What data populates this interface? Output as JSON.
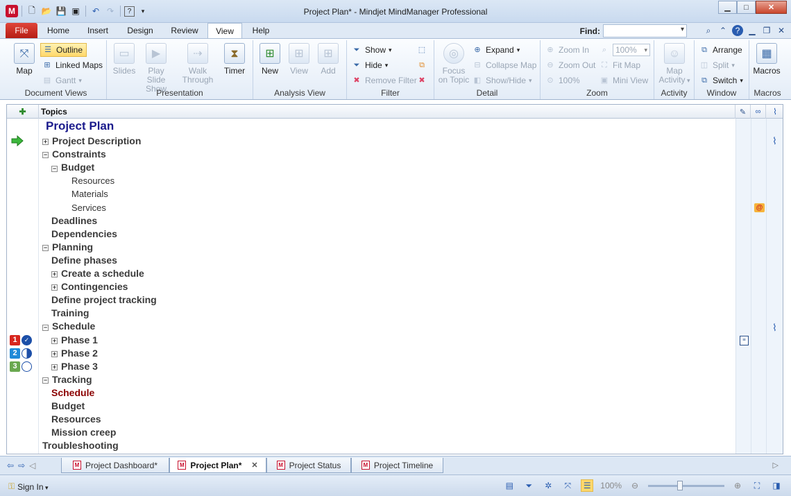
{
  "window": {
    "title": "Project Plan* - Mindjet MindManager Professional",
    "controls": {
      "minimize": "▁",
      "maximize": "□",
      "close": "✕"
    }
  },
  "qat": {
    "app_logo": "M",
    "icons": [
      "new-icon",
      "open-icon",
      "save-icon",
      "save-all-icon",
      "undo-icon",
      "redo-icon",
      "help-icon",
      "customize-icon"
    ]
  },
  "tabs": [
    {
      "label": "File"
    },
    {
      "label": "Home"
    },
    {
      "label": "Insert"
    },
    {
      "label": "Design"
    },
    {
      "label": "Review"
    },
    {
      "label": "View"
    },
    {
      "label": "Help"
    }
  ],
  "active_tab": "View",
  "find": {
    "label": "Find:",
    "value": ""
  },
  "ribbon": {
    "document_views": {
      "label": "Document Views",
      "map": "Map",
      "outline": "Outline",
      "linked_maps": "Linked Maps",
      "gantt": "Gantt"
    },
    "presentation": {
      "label": "Presentation",
      "slides": "Slides",
      "play_slide_show": [
        "Play Slide",
        "Show"
      ],
      "walk_through": [
        "Walk",
        "Through"
      ],
      "timer": "Timer"
    },
    "analysis_view": {
      "label": "Analysis View",
      "new": "New",
      "view": "View",
      "add": "Add"
    },
    "filter": {
      "label": "Filter",
      "show": "Show",
      "hide": "Hide",
      "remove_filter": "Remove Filter"
    },
    "detail": {
      "label": "Detail",
      "focus_on_topic": [
        "Focus",
        "on Topic"
      ],
      "expand": "Expand",
      "collapse_map": "Collapse Map",
      "show_hide": "Show/Hide"
    },
    "zoom": {
      "label": "Zoom",
      "zoom_in": "Zoom In",
      "zoom_out": "Zoom Out",
      "zoom_100": "100%",
      "zoom_value": "100%",
      "fit_map": "Fit Map",
      "mini_view": "Mini View"
    },
    "activity": {
      "label": "Activity",
      "map_activity": [
        "Map",
        "Activity"
      ]
    },
    "window": {
      "label": "Window",
      "arrange": "Arrange",
      "split": "Split",
      "switch": "Switch"
    },
    "macros": {
      "label": "Macros",
      "macros": "Macros"
    }
  },
  "outline": {
    "header": {
      "topics": "Topics"
    },
    "rows": [
      {
        "text": "Project Plan",
        "level": 0,
        "expander": ""
      },
      {
        "text": "Project Description",
        "level": 1,
        "expander": "+"
      },
      {
        "text": "Constraints",
        "level": 1,
        "expander": "−"
      },
      {
        "text": "Budget",
        "level": 2,
        "expander": "−"
      },
      {
        "text": "Resources",
        "level": 3,
        "expander": ""
      },
      {
        "text": "Materials",
        "level": 3,
        "expander": ""
      },
      {
        "text": "Services",
        "level": 3,
        "expander": ""
      },
      {
        "text": "Deadlines",
        "level": 2,
        "expander": ""
      },
      {
        "text": "Dependencies",
        "level": 2,
        "expander": ""
      },
      {
        "text": "Planning",
        "level": 1,
        "expander": "−"
      },
      {
        "text": "Define phases",
        "level": 2,
        "expander": ""
      },
      {
        "text": "Create a schedule",
        "level": 2,
        "expander": "+"
      },
      {
        "text": "Contingencies",
        "level": 2,
        "expander": "+"
      },
      {
        "text": "Define project tracking",
        "level": 2,
        "expander": ""
      },
      {
        "text": "Training",
        "level": 2,
        "expander": ""
      },
      {
        "text": "Schedule",
        "level": 1,
        "expander": "−"
      },
      {
        "text": "Phase 1",
        "level": 2,
        "expander": "+"
      },
      {
        "text": "Phase 2",
        "level": 2,
        "expander": "+"
      },
      {
        "text": "Phase 3",
        "level": 2,
        "expander": "+"
      },
      {
        "text": "Tracking",
        "level": 1,
        "expander": "−"
      },
      {
        "text": "Schedule",
        "level": 2,
        "expander": "",
        "selected": true
      },
      {
        "text": "Budget",
        "level": 2,
        "expander": ""
      },
      {
        "text": "Resources",
        "level": 2,
        "expander": ""
      },
      {
        "text": "Mission creep",
        "level": 2,
        "expander": ""
      },
      {
        "text": "Troubleshooting",
        "level": 1,
        "expander": ""
      }
    ],
    "priorities": [
      {
        "label": "1",
        "color": "#d7261e",
        "progress": "complete"
      },
      {
        "label": "2",
        "color": "#1f8ad8",
        "progress": "half"
      },
      {
        "label": "3",
        "color": "#6aa84f",
        "progress": "none"
      }
    ]
  },
  "doc_tabs": [
    {
      "label": "Project Dashboard*",
      "active": false
    },
    {
      "label": "Project Plan*",
      "active": true
    },
    {
      "label": "Project Status",
      "active": false
    },
    {
      "label": "Project Timeline",
      "active": false
    }
  ],
  "status": {
    "sign_in": "Sign In",
    "zoom": "100%"
  },
  "colors": {
    "accent": "#2a5db0",
    "title_topic": "#1a1a8c",
    "selected_topic": "#8b0000",
    "file_tab": "#c8241b"
  }
}
